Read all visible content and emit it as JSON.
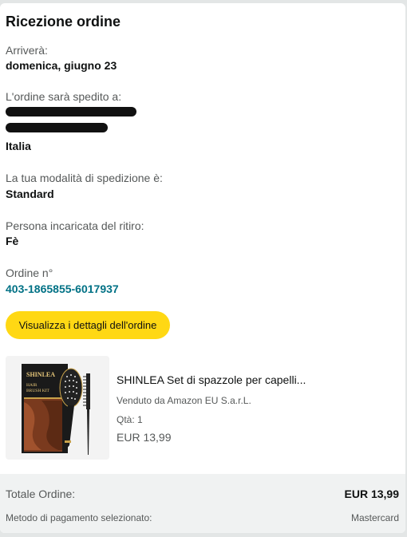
{
  "header": {
    "title": "Ricezione ordine"
  },
  "arrival": {
    "label": "Arriverà:",
    "date": "domenica, giugno 23"
  },
  "shipping": {
    "label": "L'ordine sarà spedito a:",
    "country": "Italia",
    "method_label": "La tua modalità di spedizione è:",
    "method": "Standard"
  },
  "pickup": {
    "label": "Persona incaricata del ritiro:",
    "name": "Fè"
  },
  "order": {
    "number_label": "Ordine n°",
    "number": "403-1865855-6017937",
    "details_button": "Visualizza i dettagli dell'ordine"
  },
  "item": {
    "title": "SHINLEA Set di spazzole per capelli...",
    "seller": "Venduto da Amazon EU S.a.r.L.",
    "qty": "Qtà: 1",
    "price": "EUR 13,99",
    "box_brand": "SHINLEA",
    "box_text": "HAIR BRUSH KIT"
  },
  "summary": {
    "total_label": "Totale Ordine:",
    "total_value": "EUR 13,99",
    "payment_label": "Metodo di pagamento selezionato:",
    "payment_value": "Mastercard"
  },
  "colors": {
    "accent_button": "#ffd814",
    "link": "#007185",
    "footer_bg": "#f0f2f2"
  }
}
